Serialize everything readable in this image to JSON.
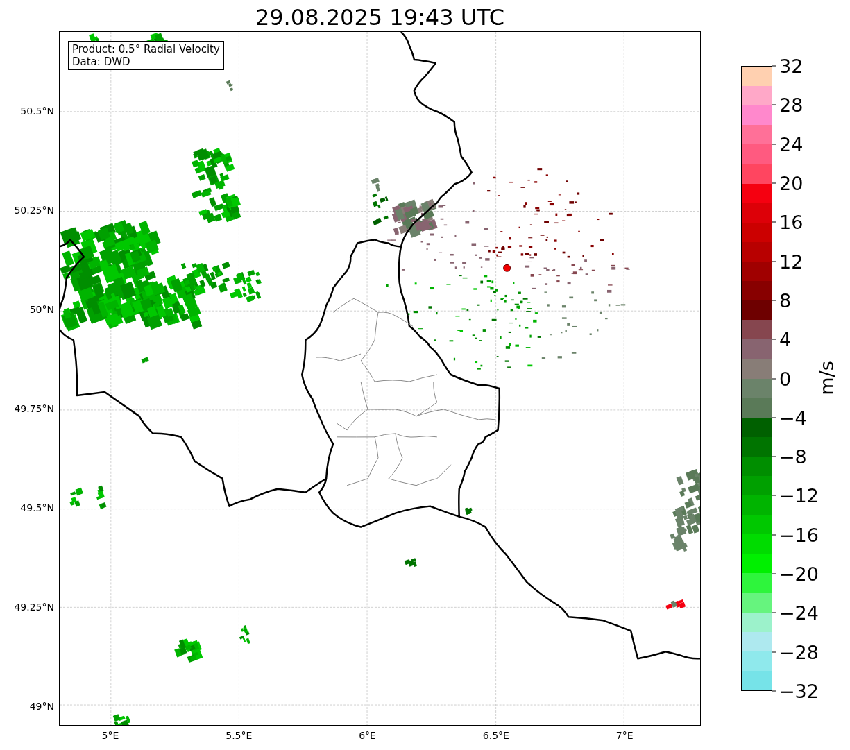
{
  "title": "29.08.2025 19:43 UTC",
  "info_box": [
    "Product: 0.5° Radial Velocity",
    "Data: DWD"
  ],
  "y_ticks": [
    "50.5°N",
    "50.25°N",
    "50°N",
    "49.75°N",
    "49.5°N",
    "49.25°N",
    "49°N"
  ],
  "x_ticks": [
    "5°E",
    "5.5°E",
    "6°E",
    "6.5°E",
    "7°E"
  ],
  "colorbar": {
    "label": "m/s",
    "ticks": [
      "32",
      "28",
      "24",
      "20",
      "16",
      "12",
      "8",
      "4",
      "0",
      "−4",
      "−8",
      "−12",
      "−16",
      "−20",
      "−24",
      "−28",
      "−32"
    ],
    "bands": [
      {
        "color": "#ffd0b0"
      },
      {
        "color": "#ffa8c8"
      },
      {
        "color": "#ff88cc"
      },
      {
        "color": "#ff7098"
      },
      {
        "color": "#ff5a80"
      },
      {
        "color": "#ff4560"
      },
      {
        "color": "#f50010"
      },
      {
        "color": "#dd0008"
      },
      {
        "color": "#cc0000"
      },
      {
        "color": "#b80000"
      },
      {
        "color": "#a00000"
      },
      {
        "color": "#880000"
      },
      {
        "color": "#6e0000"
      },
      {
        "color": "#86464f"
      },
      {
        "color": "#886470"
      },
      {
        "color": "#887d77"
      },
      {
        "color": "#6b836a"
      },
      {
        "color": "#5a7a58"
      },
      {
        "color": "#006000"
      },
      {
        "color": "#007400"
      },
      {
        "color": "#008e00"
      },
      {
        "color": "#00a000"
      },
      {
        "color": "#00b400"
      },
      {
        "color": "#00c800"
      },
      {
        "color": "#00dc00"
      },
      {
        "color": "#00f000"
      },
      {
        "color": "#2ef53c"
      },
      {
        "color": "#66f47e"
      },
      {
        "color": "#9cf2cb"
      },
      {
        "color": "#aee9ef"
      },
      {
        "color": "#8fe9ec"
      },
      {
        "color": "#76e3e8"
      }
    ]
  }
}
